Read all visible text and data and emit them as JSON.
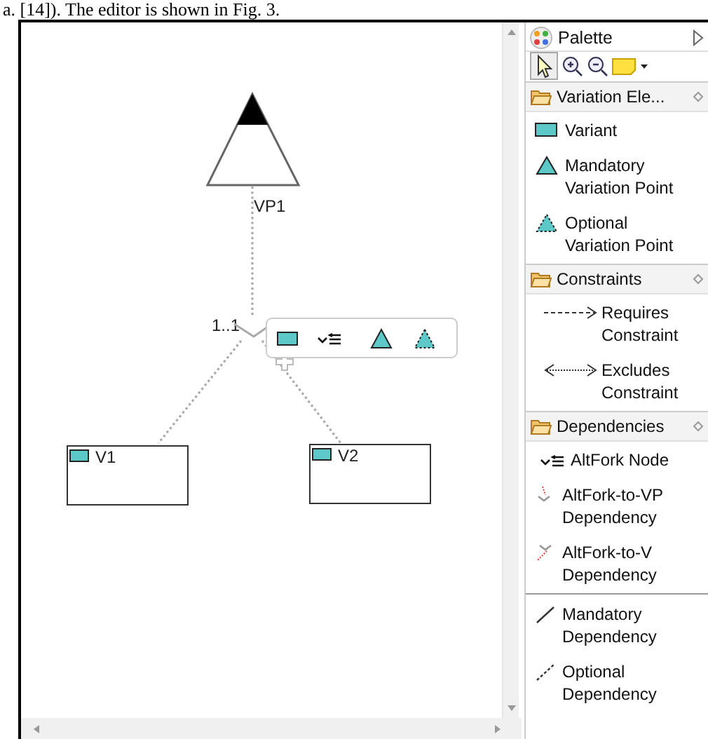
{
  "caption": "a. [14]). The editor is shown in Fig. 3.",
  "diagram": {
    "variation_point": {
      "label": "VP1"
    },
    "fork": {
      "cardinality": "1..1"
    },
    "variants": [
      {
        "label": "V1"
      },
      {
        "label": "V2"
      }
    ],
    "popup_tools": [
      {
        "kind": "variant"
      },
      {
        "kind": "altfork"
      },
      {
        "kind": "mandatory"
      },
      {
        "kind": "optional"
      }
    ]
  },
  "palette": {
    "title": "Palette",
    "drawers": [
      {
        "title": "Variation Ele...",
        "items": [
          {
            "kind": "variant",
            "label": "Variant"
          },
          {
            "kind": "mandatory",
            "label": "Mandatory Variation Point"
          },
          {
            "kind": "optional",
            "label": "Optional Variation Point"
          }
        ]
      },
      {
        "title": "Constraints",
        "items": [
          {
            "kind": "requires",
            "label": "Requires Constraint"
          },
          {
            "kind": "excludes",
            "label": "Excludes Constraint"
          }
        ]
      },
      {
        "title": "Dependencies",
        "items": [
          {
            "kind": "altfork",
            "label": "AltFork Node"
          },
          {
            "kind": "altfork_vp",
            "label": "AltFork-to-VP Dependency"
          },
          {
            "kind": "altfork_v",
            "label": "AltFork-to-V Dependency"
          },
          {
            "kind": "separator"
          },
          {
            "kind": "mandatory_dep",
            "label": "Mandatory Dependency"
          },
          {
            "kind": "optional_dep",
            "label": "Optional Dependency"
          }
        ]
      }
    ]
  }
}
